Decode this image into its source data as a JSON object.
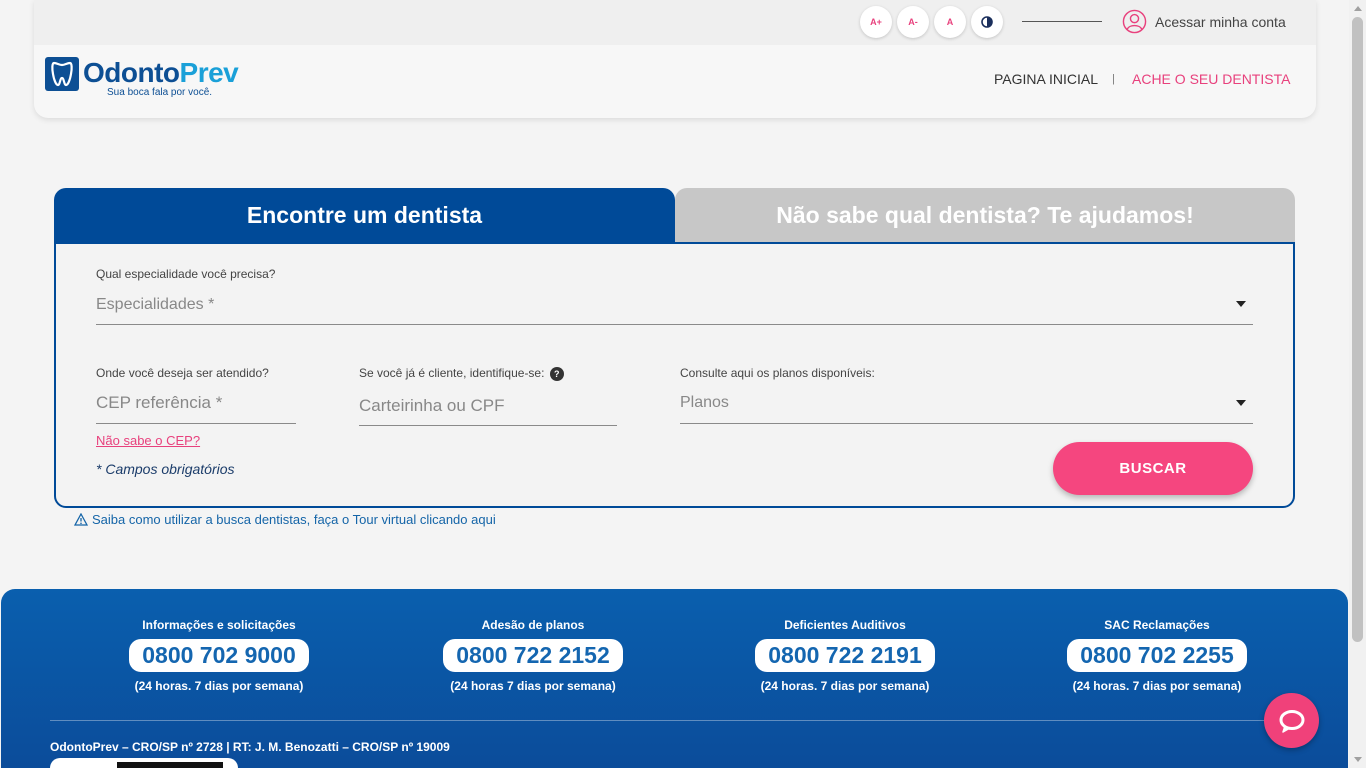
{
  "header": {
    "accessibility": [
      {
        "label": "A+",
        "name": "font-increase-button"
      },
      {
        "label": "A-",
        "name": "font-decrease-button"
      },
      {
        "label": "A",
        "name": "font-reset-button"
      }
    ],
    "contrast_icon": "contrast-icon",
    "account_label": "Acessar minha conta",
    "brand": {
      "name_part1": "Odonto",
      "name_part2": "Prev",
      "slogan": "Sua boca fala por você."
    },
    "nav": {
      "home": "PAGINA INICIAL",
      "separator": "|",
      "find_dentist": "ACHE O SEU DENTISTA"
    }
  },
  "search": {
    "tabs": {
      "active": "Encontre um dentista",
      "inactive": "Não sabe qual dentista? Te ajudamos!"
    },
    "specialty": {
      "label": "Qual especialidade você precisa?",
      "placeholder": "Especialidades *"
    },
    "location": {
      "label": "Onde você deseja ser atendido?",
      "placeholder": "CEP referência *"
    },
    "client": {
      "label": "Se você já é cliente, identifique-se:",
      "help": "?",
      "placeholder": "Carteirinha ou CPF"
    },
    "plans": {
      "label": "Consulte aqui os planos disponíveis:",
      "placeholder": "Planos"
    },
    "cep_link": "Não sabe o CEP?",
    "required_note": "* Campos obrigatórios",
    "submit_label": "BUSCAR"
  },
  "tour": {
    "icon": "warning-icon",
    "text": "Saiba como utilizar a busca dentistas, faça o Tour virtual clicando aqui"
  },
  "footer": {
    "contacts": [
      {
        "title": "Informações e solicitações",
        "phone": "0800 702 9000",
        "hours": "(24 horas. 7 dias por semana)"
      },
      {
        "title": "Adesão de planos",
        "phone": "0800 722 2152",
        "hours": "(24 horas 7 dias por semana)"
      },
      {
        "title": "Deficientes Auditivos",
        "phone": "0800 722 2191",
        "hours": "(24 horas. 7 dias por semana)"
      },
      {
        "title": "SAC Reclamações",
        "phone": "0800 702 2255",
        "hours": "(24 horas. 7 dias por semana)"
      }
    ],
    "legal": "OdontoPrev – CRO/SP nº 2728 | RT: J. M. Benozatti – CRO/SP nº 19009"
  },
  "chat_icon": "chat-bubble-icon",
  "colors": {
    "brand_blue": "#004a98",
    "accent_pink": "#f5467f",
    "footer_blue": "#0a5fae",
    "tab_inactive": "#c7c7c7"
  }
}
